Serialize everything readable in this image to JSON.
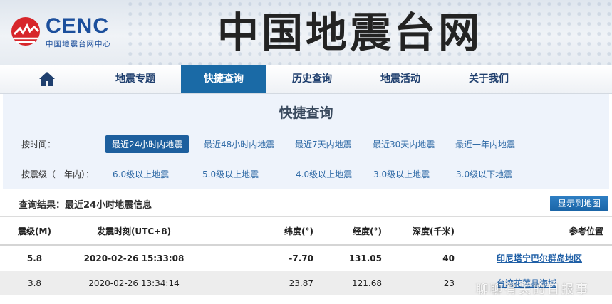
{
  "header": {
    "logo_text": "CENC",
    "logo_subtitle": "中国地震台网中心",
    "site_title": "中国地震台网",
    "colors": {
      "logo_red": "#d7262b",
      "logo_blue": "#1c4f9c"
    }
  },
  "nav": {
    "home_icon": "home-icon",
    "items": [
      {
        "label": "地震专题"
      },
      {
        "label": "快捷查询",
        "active": true
      },
      {
        "label": "历史查询"
      },
      {
        "label": "地震活动"
      },
      {
        "label": "关于我们"
      }
    ]
  },
  "query": {
    "title": "快捷查询",
    "time_label": "按时间：",
    "time_options": [
      "最近24小时内地震",
      "最近48小时内地震",
      "最近7天内地震",
      "最近30天内地震",
      "最近一年内地震"
    ],
    "magnitude_label": "按震级（一年内）：",
    "magnitude_options": [
      "6.0级以上地震",
      "5.0级以上地震",
      "4.0级以上地震",
      "3.0级以上地震",
      "3.0级以下地震"
    ]
  },
  "results": {
    "title": "查询结果：最近24小时地震信息",
    "map_button": "显示到地图",
    "columns": [
      "震级(M)",
      "发震时刻(UTC+8)",
      "纬度(°)",
      "经度(°)",
      "深度(千米)",
      "参考位置"
    ],
    "rows": [
      {
        "magnitude": "5.8",
        "time": "2020-02-26 15:33:08",
        "lat": "-7.70",
        "lon": "131.05",
        "depth": "40",
        "location": "印尼塔宁巴尔群岛地区"
      },
      {
        "magnitude": "3.8",
        "time": "2020-02-26 13:34:14",
        "lat": "23.87",
        "lon": "121.68",
        "depth": "23",
        "location": "台湾花莲县海域"
      }
    ]
  },
  "watermark": "聊聊有关的日报事"
}
